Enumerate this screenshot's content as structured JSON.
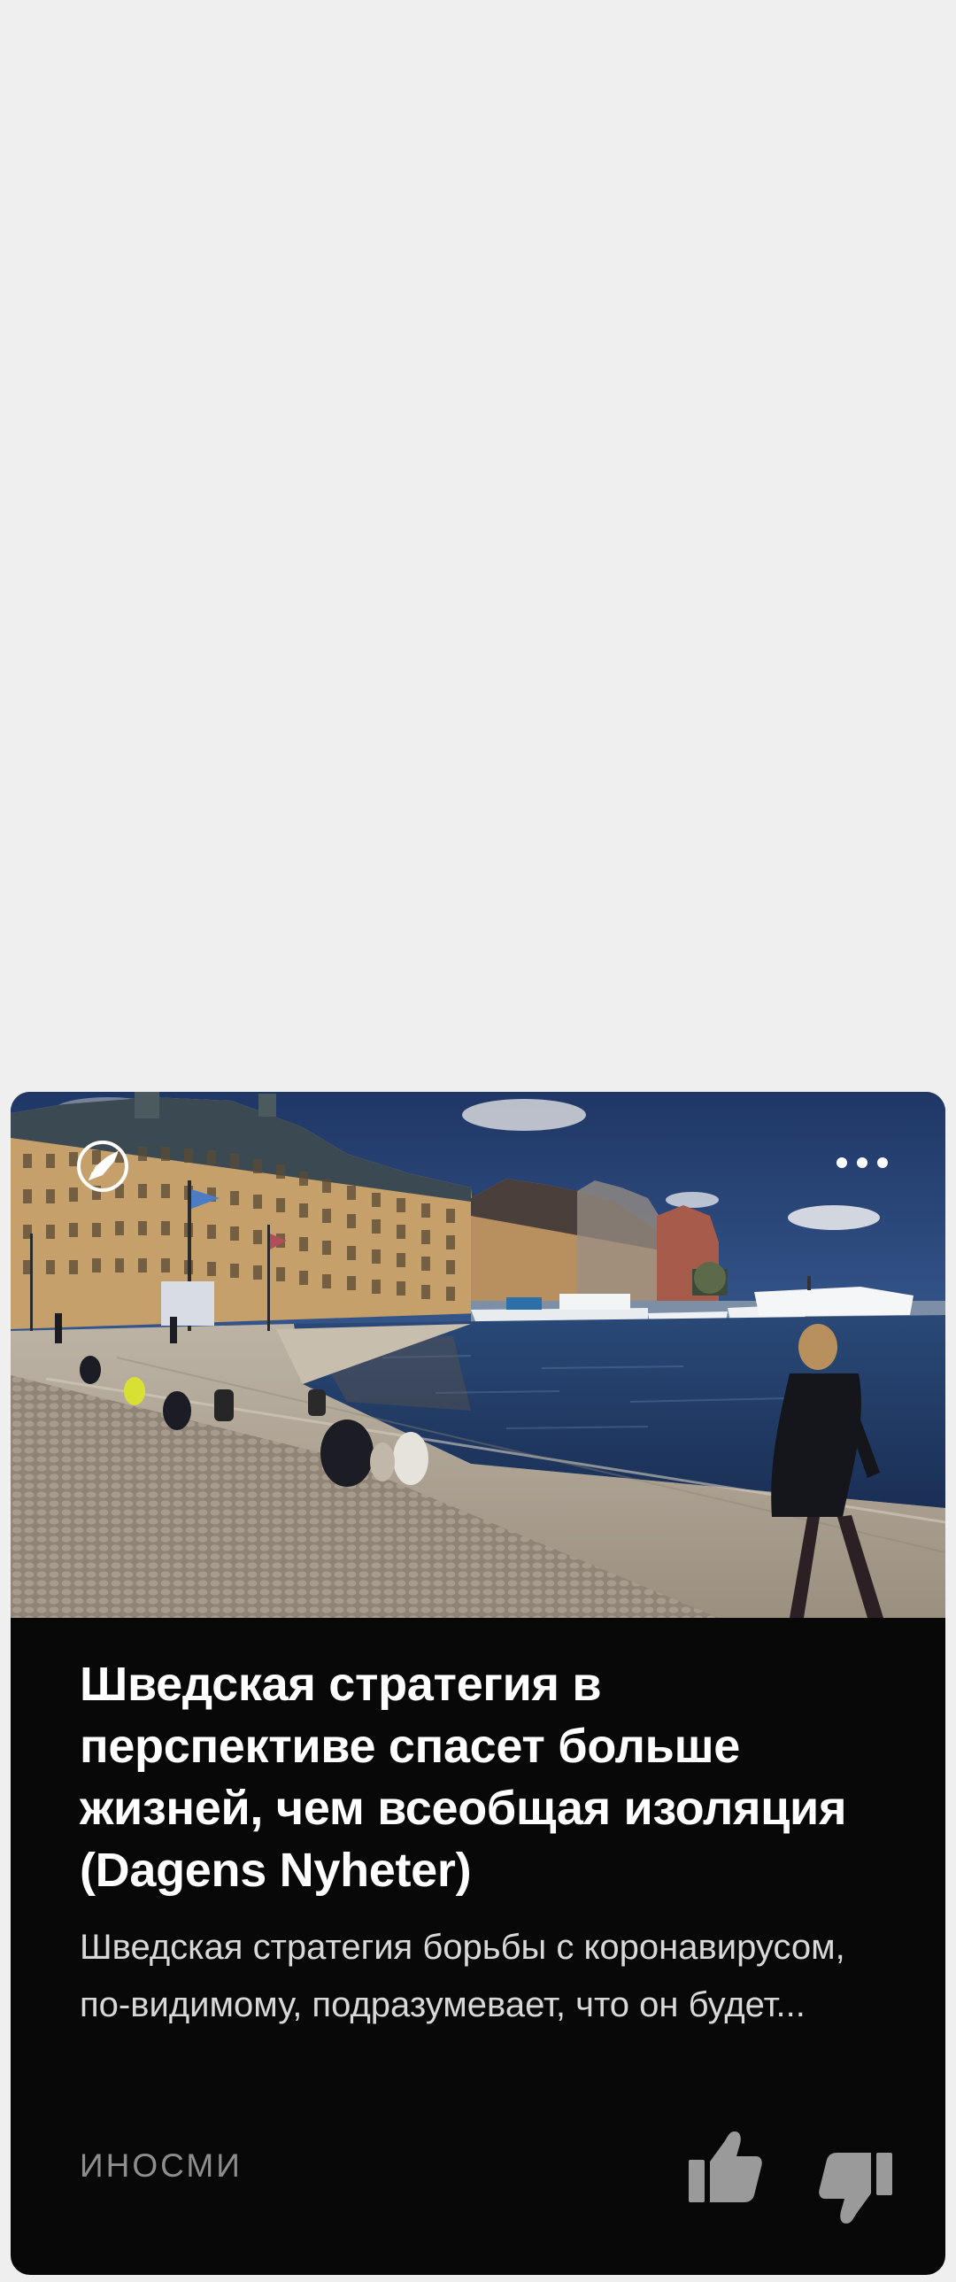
{
  "card": {
    "image": {
      "description_icon": "photo-harbor",
      "source_logo_icon": "rocket-icon"
    },
    "headline": "Шведская стратегия в перспективе спасет больше жизней, чем всеобщая изоляция (Dagens Nyheter)",
    "snippet": "Шведская стратегия борьбы с коронавирусом, по-видимому, подразумевает, что он будет...",
    "source": "ИНОСМИ",
    "more_icon": "more-dots-icon",
    "like_icon": "thumbs-up-icon",
    "dislike_icon": "thumbs-down-icon"
  },
  "colors": {
    "page_background": "#efeff0",
    "card_background": "#080808",
    "headline": "#ffffff",
    "snippet": "#d8d8d8",
    "source": "#8e8e8e",
    "icon": "#9a9a9a"
  }
}
